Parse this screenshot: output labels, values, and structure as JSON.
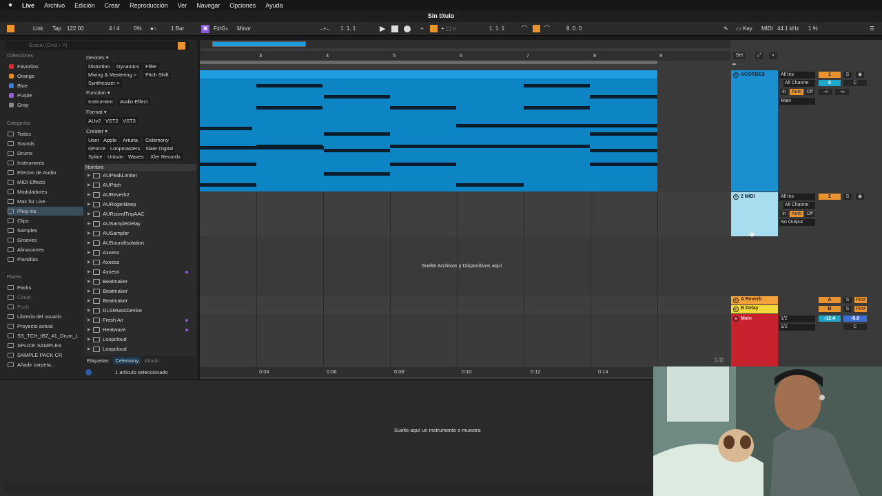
{
  "menu": {
    "app": "Live",
    "items": [
      "Archivo",
      "Edición",
      "Crear",
      "Reproducción",
      "Ver",
      "Navegar",
      "Opciones",
      "Ayuda"
    ]
  },
  "title": "Sin título",
  "transport": {
    "link": "Link",
    "tap": "Tap",
    "tempo": "122.00",
    "signature": "4 / 4",
    "metro_pct": "0%",
    "quant": "1 Bar",
    "key": "F♯/G♭",
    "scale": "Minor",
    "position": "1.  1.  1",
    "loop_start": "1.  1.  1",
    "loop_len": "8.  0.  0",
    "keylbl": "Key",
    "midilbl": "MIDI",
    "sample_rate": "44.1 kHz",
    "cpu": "1 %"
  },
  "browser": {
    "search_placeholder": "Buscar (Cmd + F)",
    "collections_title": "Colecciones",
    "collections": [
      {
        "label": "Favoritos",
        "color": "#e0262c"
      },
      {
        "label": "Orange",
        "color": "#f08a1e"
      },
      {
        "label": "Blue",
        "color": "#3b7fe0"
      },
      {
        "label": "Purple",
        "color": "#a05ad6"
      },
      {
        "label": "Gray",
        "color": "#8a8a8a"
      }
    ],
    "categories_title": "Categorías",
    "categories": [
      "Todos",
      "Sounds",
      "Drums",
      "Instruments",
      "Efectos de Audio",
      "MIDI Effects",
      "Moduladores",
      "Max for Live",
      "Plug-Ins",
      "Clips",
      "Samples",
      "Grooves",
      "Afinaciones",
      "Plantillas"
    ],
    "places_title": "Places",
    "places": [
      "Packs",
      "Cloud",
      "Push",
      "Librería del usuario",
      "Proyecto actual",
      "SS_TCH_tBZ_#1_Drum_L",
      "SPLICE SAMPLES",
      "SAMPLE PACK CR",
      "Añadir carpeta..."
    ],
    "devices_title": "Devices ▾",
    "device_chips": [
      "Distortion",
      "Dynamics",
      "Filter",
      "Mixing & Mastering >",
      "Pitch Shift",
      "Synthesizer >"
    ],
    "function_title": "Function ▾",
    "function_chips": [
      "Instrument",
      "Audio Effect"
    ],
    "format_title": "Format ▾",
    "format_chips": [
      "AUv2",
      "VST2",
      "VST3"
    ],
    "creator_title": "Creator ▾",
    "creator_chips": [
      "User",
      "Apple",
      "Arturia",
      "Celemony",
      "GForce",
      "Loopmasters",
      "Slate Digital",
      "Splice",
      "Unison",
      "Waves",
      "Xfer Records"
    ],
    "list_header": "Nombre",
    "files": [
      "AUPeakLimiter",
      "AUPitch",
      "AUReverb2",
      "AURogerBeep",
      "AURoundTripAAC",
      "AUSampleDelay",
      "AUSampler",
      "AUSoundIsolation",
      "Axxess",
      "Axxess",
      "Axxess",
      "Beatmaker",
      "Beatmaker",
      "Beatmaker",
      "DLSMusicDevice",
      "Fresh Air",
      "Heatwave",
      "Loopcloud",
      "Loopcloud"
    ],
    "tags_label": "Etiquetas:",
    "tag": "Celemony",
    "tag_add": "Añadir...",
    "status": "1 artículo seleccionado"
  },
  "arrangement": {
    "bar_labels": [
      "3",
      "4",
      "5",
      "6",
      "7",
      "8",
      "9"
    ],
    "time_labels": [
      "0:04",
      "0:06",
      "0:08",
      "0:10",
      "0:12",
      "0:14"
    ],
    "drop_files": "Suelte Archivos y Dispositivos aquí",
    "zoom": "1/8"
  },
  "mixer": {
    "set": "Set",
    "tracks": [
      {
        "name": "ACORDES",
        "color": "#1b8fd0",
        "input": "All Ins",
        "channel": "All Channe",
        "in": "In",
        "auto": "Auto",
        "off": "Off",
        "output": "Main",
        "num": "1",
        "s": "S",
        "vol": "0",
        "pan": "C",
        "sends": [
          "-∞",
          "-∞"
        ]
      },
      {
        "name": "2 MIDI",
        "color": "#a8dcef",
        "input": "All Ins",
        "channel": "All Channe",
        "in": "In",
        "auto": "Auto",
        "off": "Off",
        "output": "No Output",
        "num": "2",
        "s": "S"
      }
    ],
    "returns": [
      {
        "name": "A Reverb",
        "color": "#f2a23a",
        "letter": "A",
        "s": "S",
        "post": "Post"
      },
      {
        "name": "B Delay",
        "color": "#f2d93a",
        "letter": "B",
        "s": "S",
        "post": "Post"
      }
    ],
    "main": {
      "name": "Main",
      "color": "#c8232c",
      "out1": "1/2",
      "out2": "1/2",
      "vol": "-12.4",
      "vol2": "-6.0",
      "pan": "C"
    }
  },
  "detail": {
    "drop_instrument": "Suelte aquí un Instrumento o muestra"
  }
}
